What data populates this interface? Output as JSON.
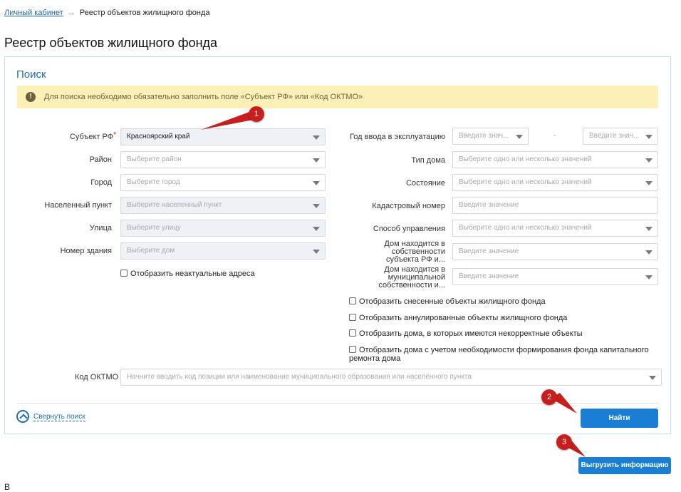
{
  "breadcrumb": {
    "home": "Личный кабинет",
    "arrow": "→",
    "current": "Реестр объектов жилищного фонда"
  },
  "page_title": "Реестр объектов жилищного фонда",
  "search": {
    "title": "Поиск",
    "alert": "Для поиска необходимо обязательно заполнить поле «Субъект РФ» или «Код ОКТМО»",
    "alert_icon": "!",
    "left_fields": [
      {
        "label": "Субъект РФ",
        "required": "*",
        "value": "Красноярский край"
      },
      {
        "label": "Район",
        "placeholder": "Выберите район"
      },
      {
        "label": "Город",
        "placeholder": "Выберите город"
      },
      {
        "label": "Населенный пункт",
        "placeholder": "Выберите населенный пункт"
      },
      {
        "label": "Улица",
        "placeholder": "Выберите улицу"
      },
      {
        "label": "Номер здания",
        "placeholder": "Выберите дом"
      }
    ],
    "show_inactive_addresses": "Отобразить неактуальные адреса",
    "right_fields": {
      "year": {
        "label": "Год ввода в эксплуатацию",
        "from_placeholder": "Введите знач...",
        "dash": "-",
        "to_placeholder": "Введите знач..."
      },
      "house_type": {
        "label": "Тип дома",
        "placeholder": "Выберите одно или несколько значений"
      },
      "state": {
        "label": "Состояние",
        "placeholder": "Выберите одно или несколько значений"
      },
      "cadastral": {
        "label": "Кадастровый номер",
        "placeholder": "Введите значение"
      },
      "management": {
        "label": "Способ управления",
        "placeholder": "Выберите одно или несколько значений"
      },
      "subject_ownership": {
        "label": "Дом находится в собственности субъекта РФ и...",
        "placeholder": "Введите значение"
      },
      "municipal_ownership": {
        "label": "Дом находится в муниципальной собственности и...",
        "placeholder": "Введите значение"
      }
    },
    "checkboxes": [
      "Отобразить снесенные объекты жилищного фонда",
      "Отобразить аннулированные объекты жилищного фонда",
      "Отобразить дома, в которых имеются некорректные объекты",
      "Отобразить дома с учетом необходимости формирования фонда капитального ремонта дома"
    ],
    "oktmo": {
      "label": "Код ОКТМО",
      "placeholder": "Начните вводить код позиции или наименование муниципального образования или населённого пункта"
    },
    "collapse": "Свернуть поиск",
    "find_button": "Найти"
  },
  "export_button": "Выгрузить информацию",
  "markers": [
    "1",
    "2",
    "3"
  ],
  "footer_text": "В",
  "colors": {
    "accent": "#1a7fd4",
    "alert_bg": "#fdf0b6",
    "marker": "#c81e1e",
    "link": "#2166a8"
  }
}
